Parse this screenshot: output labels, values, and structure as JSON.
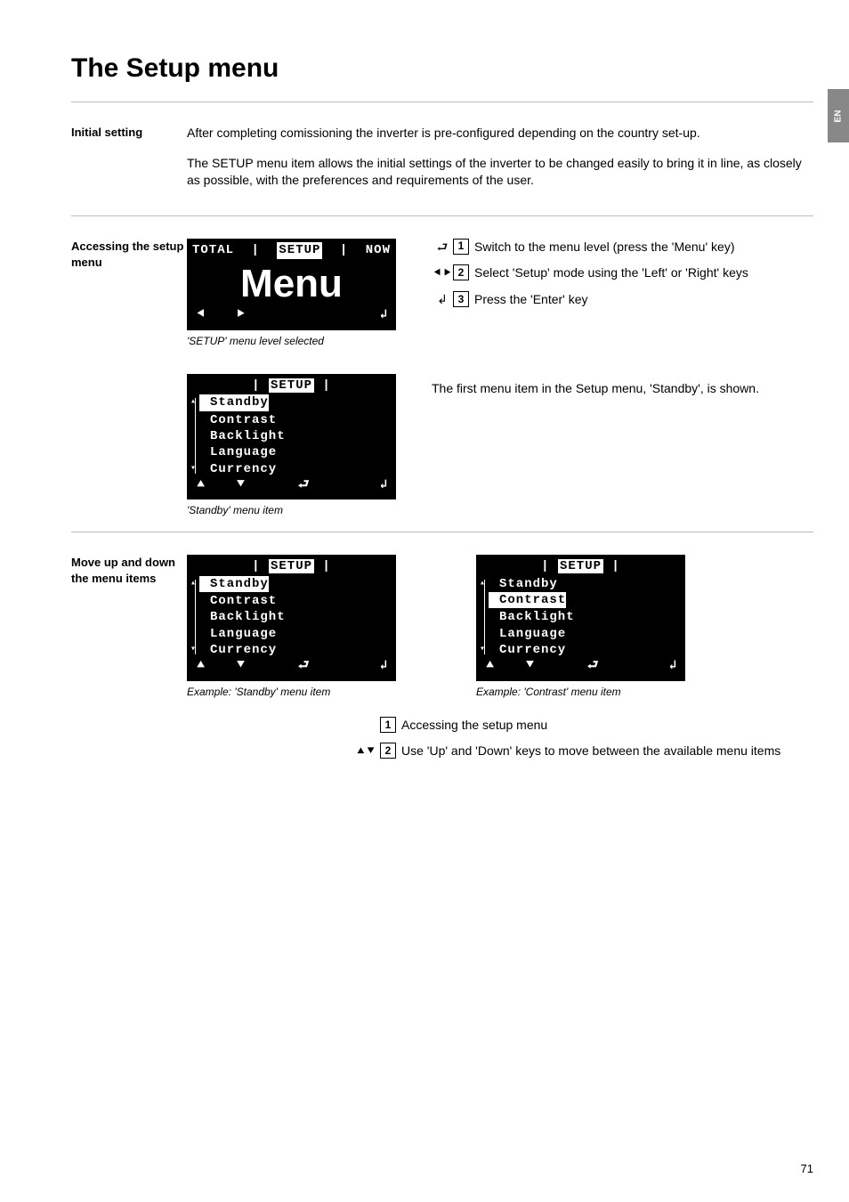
{
  "page": {
    "title": "The Setup menu",
    "number": "71",
    "langTab": "EN"
  },
  "section1": {
    "heading": "Initial setting",
    "para1": "After completing comissioning the inverter is pre-configured depending on the country set-up.",
    "para2": "The SETUP menu item allows the initial settings of the inverter to be changed easily to bring it in line, as closely as possible, with the preferences and requirements of the user."
  },
  "section2": {
    "heading": "Accessing the setup menu",
    "lcd1": {
      "left": "TOTAL",
      "mid": "SETUP",
      "right": "NOW",
      "big": "Menu",
      "caption": "'SETUP' menu level selected"
    },
    "lcd2": {
      "header": "SETUP",
      "items": [
        "Standby",
        "Contrast",
        "Backlight",
        "Language",
        "Currency"
      ],
      "caption": "'Standby' menu item"
    },
    "steps": {
      "s1": "Switch to the menu level (press the 'Menu' key)",
      "s2": "Select 'Setup' mode using the 'Left' or 'Right' keys",
      "s3": "Press the 'Enter' key",
      "note": "The first menu item in the Setup menu, 'Standby', is shown."
    }
  },
  "section3": {
    "heading": "Move up and down the menu items",
    "lcdA": {
      "header": "SETUP",
      "items": [
        "Standby",
        "Contrast",
        "Backlight",
        "Language",
        "Currency"
      ],
      "caption": "Example: 'Standby' menu item"
    },
    "lcdB": {
      "header": "SETUP",
      "items": [
        "Standby",
        "Contrast",
        "Backlight",
        "Language",
        "Currency"
      ],
      "caption": "Example: 'Contrast' menu item"
    },
    "steps": {
      "s1": "Accessing the setup menu",
      "s2": "Use 'Up' and 'Down' keys to move between the available menu items"
    }
  }
}
